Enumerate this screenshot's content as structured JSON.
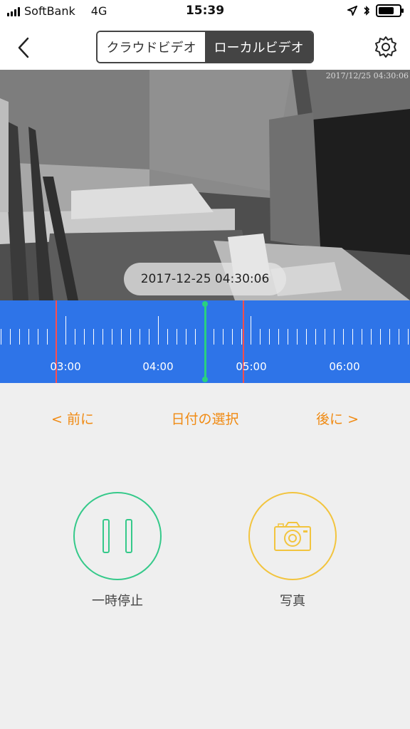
{
  "status_bar": {
    "carrier": "SoftBank",
    "network": "4G",
    "time": "15:39",
    "icons": [
      "signal-icon",
      "location-arrow-icon",
      "bluetooth-icon",
      "battery-icon"
    ],
    "battery_level": 0.75
  },
  "nav": {
    "back_icon": "chevron-left-icon",
    "segments": [
      "クラウドビデオ",
      "ローカルビデオ"
    ],
    "selected_segment": "ローカルビデオ",
    "settings_icon": "gear-icon"
  },
  "video": {
    "overlay_timestamp": "2017/12/25 04:30:06",
    "playback_timestamp": "2017-12-25 04:30:06"
  },
  "timeline": {
    "labels": [
      "03:00",
      "04:00",
      "05:00",
      "06:00"
    ],
    "colors": {
      "background": "#2e74e8",
      "cursor": "#29d07f",
      "marker": "#ff4d4d"
    }
  },
  "date_nav": {
    "prev": "< 前に",
    "select": "日付の選択",
    "next": "後に >"
  },
  "controls": {
    "pause_label": "一時停止",
    "photo_label": "写真",
    "pause_color": "#35c98a",
    "photo_color": "#f2c43e"
  },
  "accent_color": "#f08a12"
}
